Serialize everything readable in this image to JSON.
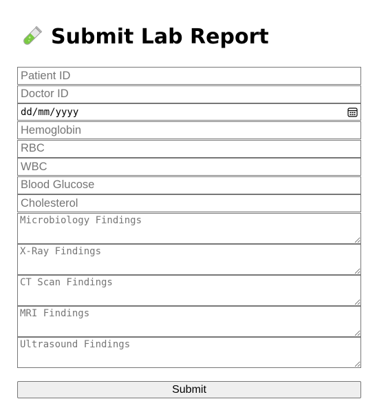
{
  "page": {
    "title": "Submit Lab Report",
    "title_icon": "test-tube-icon"
  },
  "form": {
    "patient_id": {
      "placeholder": "Patient ID",
      "value": ""
    },
    "doctor_id": {
      "placeholder": "Doctor ID",
      "value": ""
    },
    "date": {
      "placeholder": "dd/mm/yyyy",
      "icon": "calendar-icon"
    },
    "hemoglobin": {
      "placeholder": "Hemoglobin",
      "value": ""
    },
    "rbc": {
      "placeholder": "RBC",
      "value": ""
    },
    "wbc": {
      "placeholder": "WBC",
      "value": ""
    },
    "blood_glucose": {
      "placeholder": "Blood Glucose",
      "value": ""
    },
    "cholesterol": {
      "placeholder": "Cholesterol",
      "value": ""
    },
    "microbiology": {
      "placeholder": "Microbiology Findings"
    },
    "xray": {
      "placeholder": "X-Ray Findings"
    },
    "ct_scan": {
      "placeholder": "CT Scan Findings"
    },
    "mri": {
      "placeholder": "MRI Findings"
    },
    "ultrasound": {
      "placeholder": "Ultrasound Findings"
    },
    "submit_label": "Submit"
  }
}
